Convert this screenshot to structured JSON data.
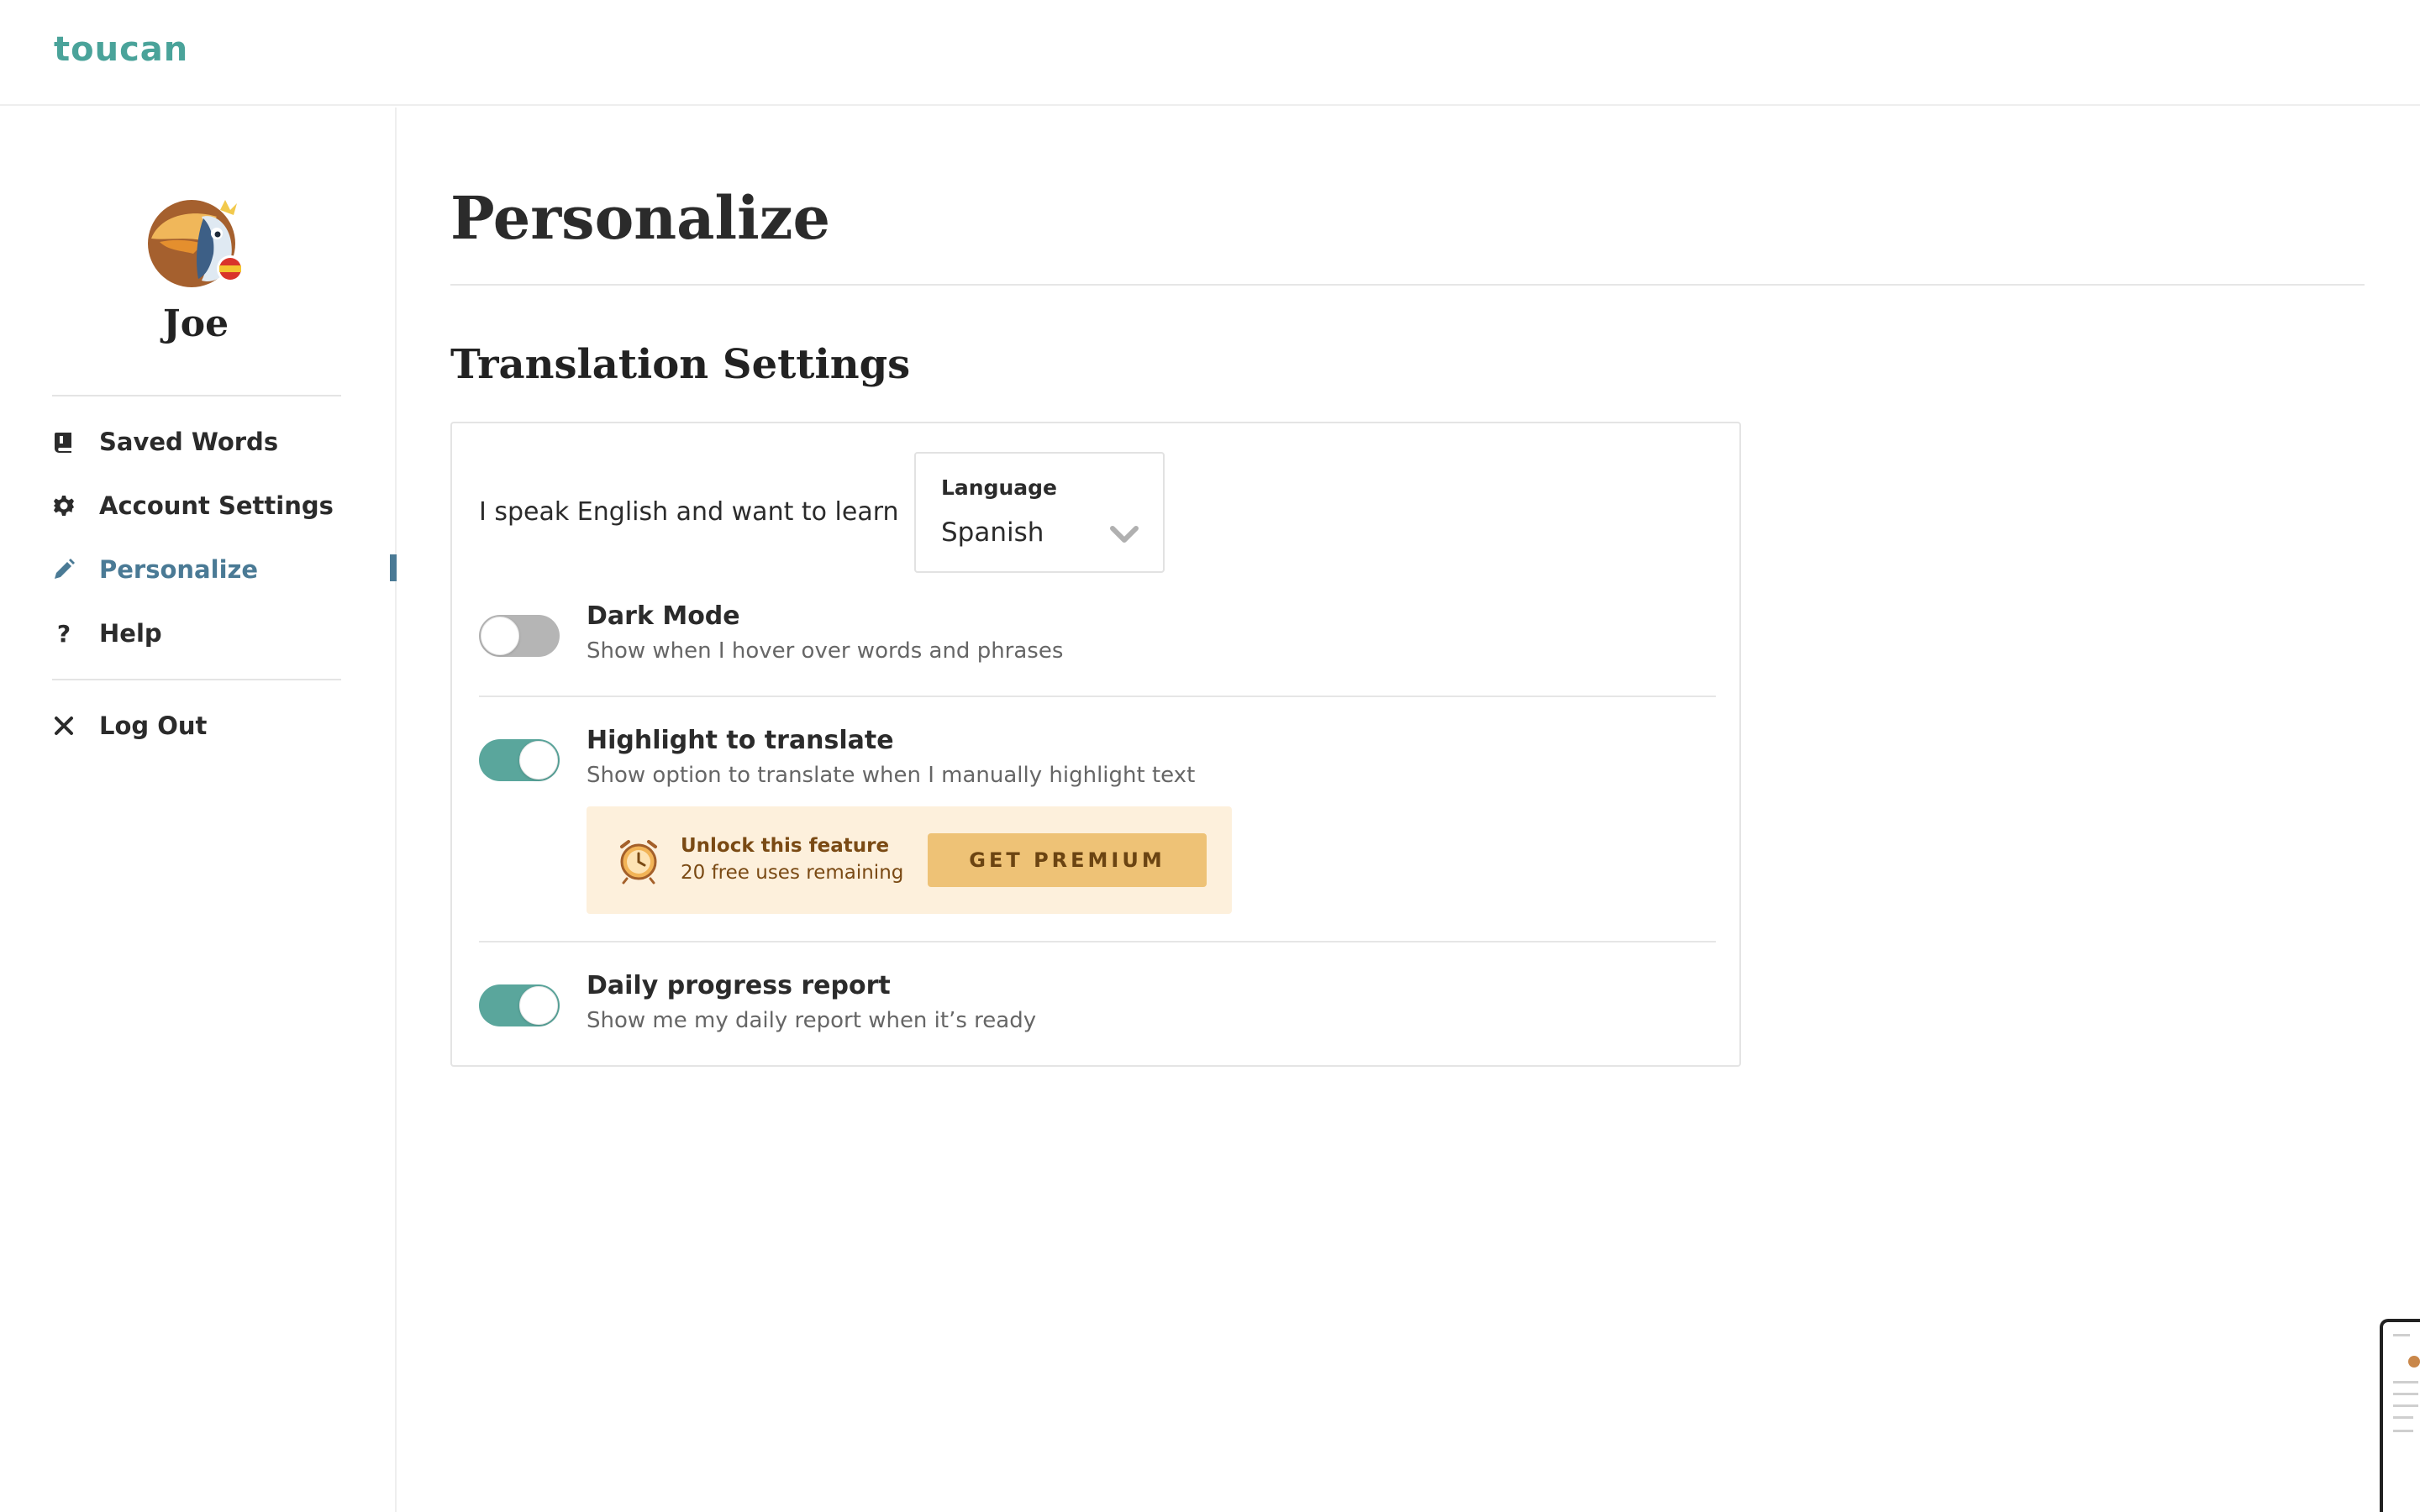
{
  "app": {
    "logo": "toucan"
  },
  "sidebar": {
    "user_name": "Joe",
    "items": [
      {
        "label": "Saved Words",
        "icon": "book-icon"
      },
      {
        "label": "Account Settings",
        "icon": "gear-icon"
      },
      {
        "label": "Personalize",
        "icon": "pencil-icon",
        "active": true
      },
      {
        "label": "Help",
        "icon": "question-icon"
      }
    ],
    "logout": {
      "label": "Log Out",
      "icon": "close-icon"
    }
  },
  "main": {
    "page_title": "Personalize",
    "section_title": "Translation Settings",
    "language": {
      "prompt": "I speak English and want to learn",
      "label": "Language",
      "value": "Spanish"
    },
    "options": [
      {
        "title": "Dark Mode",
        "description": "Show when I hover over words and phrases",
        "enabled": false
      },
      {
        "title": "Highlight to translate",
        "description": "Show option to translate when I manually highlight text",
        "enabled": true
      },
      {
        "title": "Daily progress report",
        "description": "Show me my daily report when it’s ready",
        "enabled": true
      }
    ],
    "premium": {
      "title": "Unlock this feature",
      "subtitle": "20 free uses remaining",
      "button_label": "GET PREMIUM"
    }
  },
  "colors": {
    "brand": "#4aa39a",
    "active_nav": "#4a7a95",
    "toggle_on": "#5aa69c",
    "toggle_off": "#b5b5b5",
    "premium_bg": "#fdf0dc",
    "premium_button": "#eec276"
  }
}
